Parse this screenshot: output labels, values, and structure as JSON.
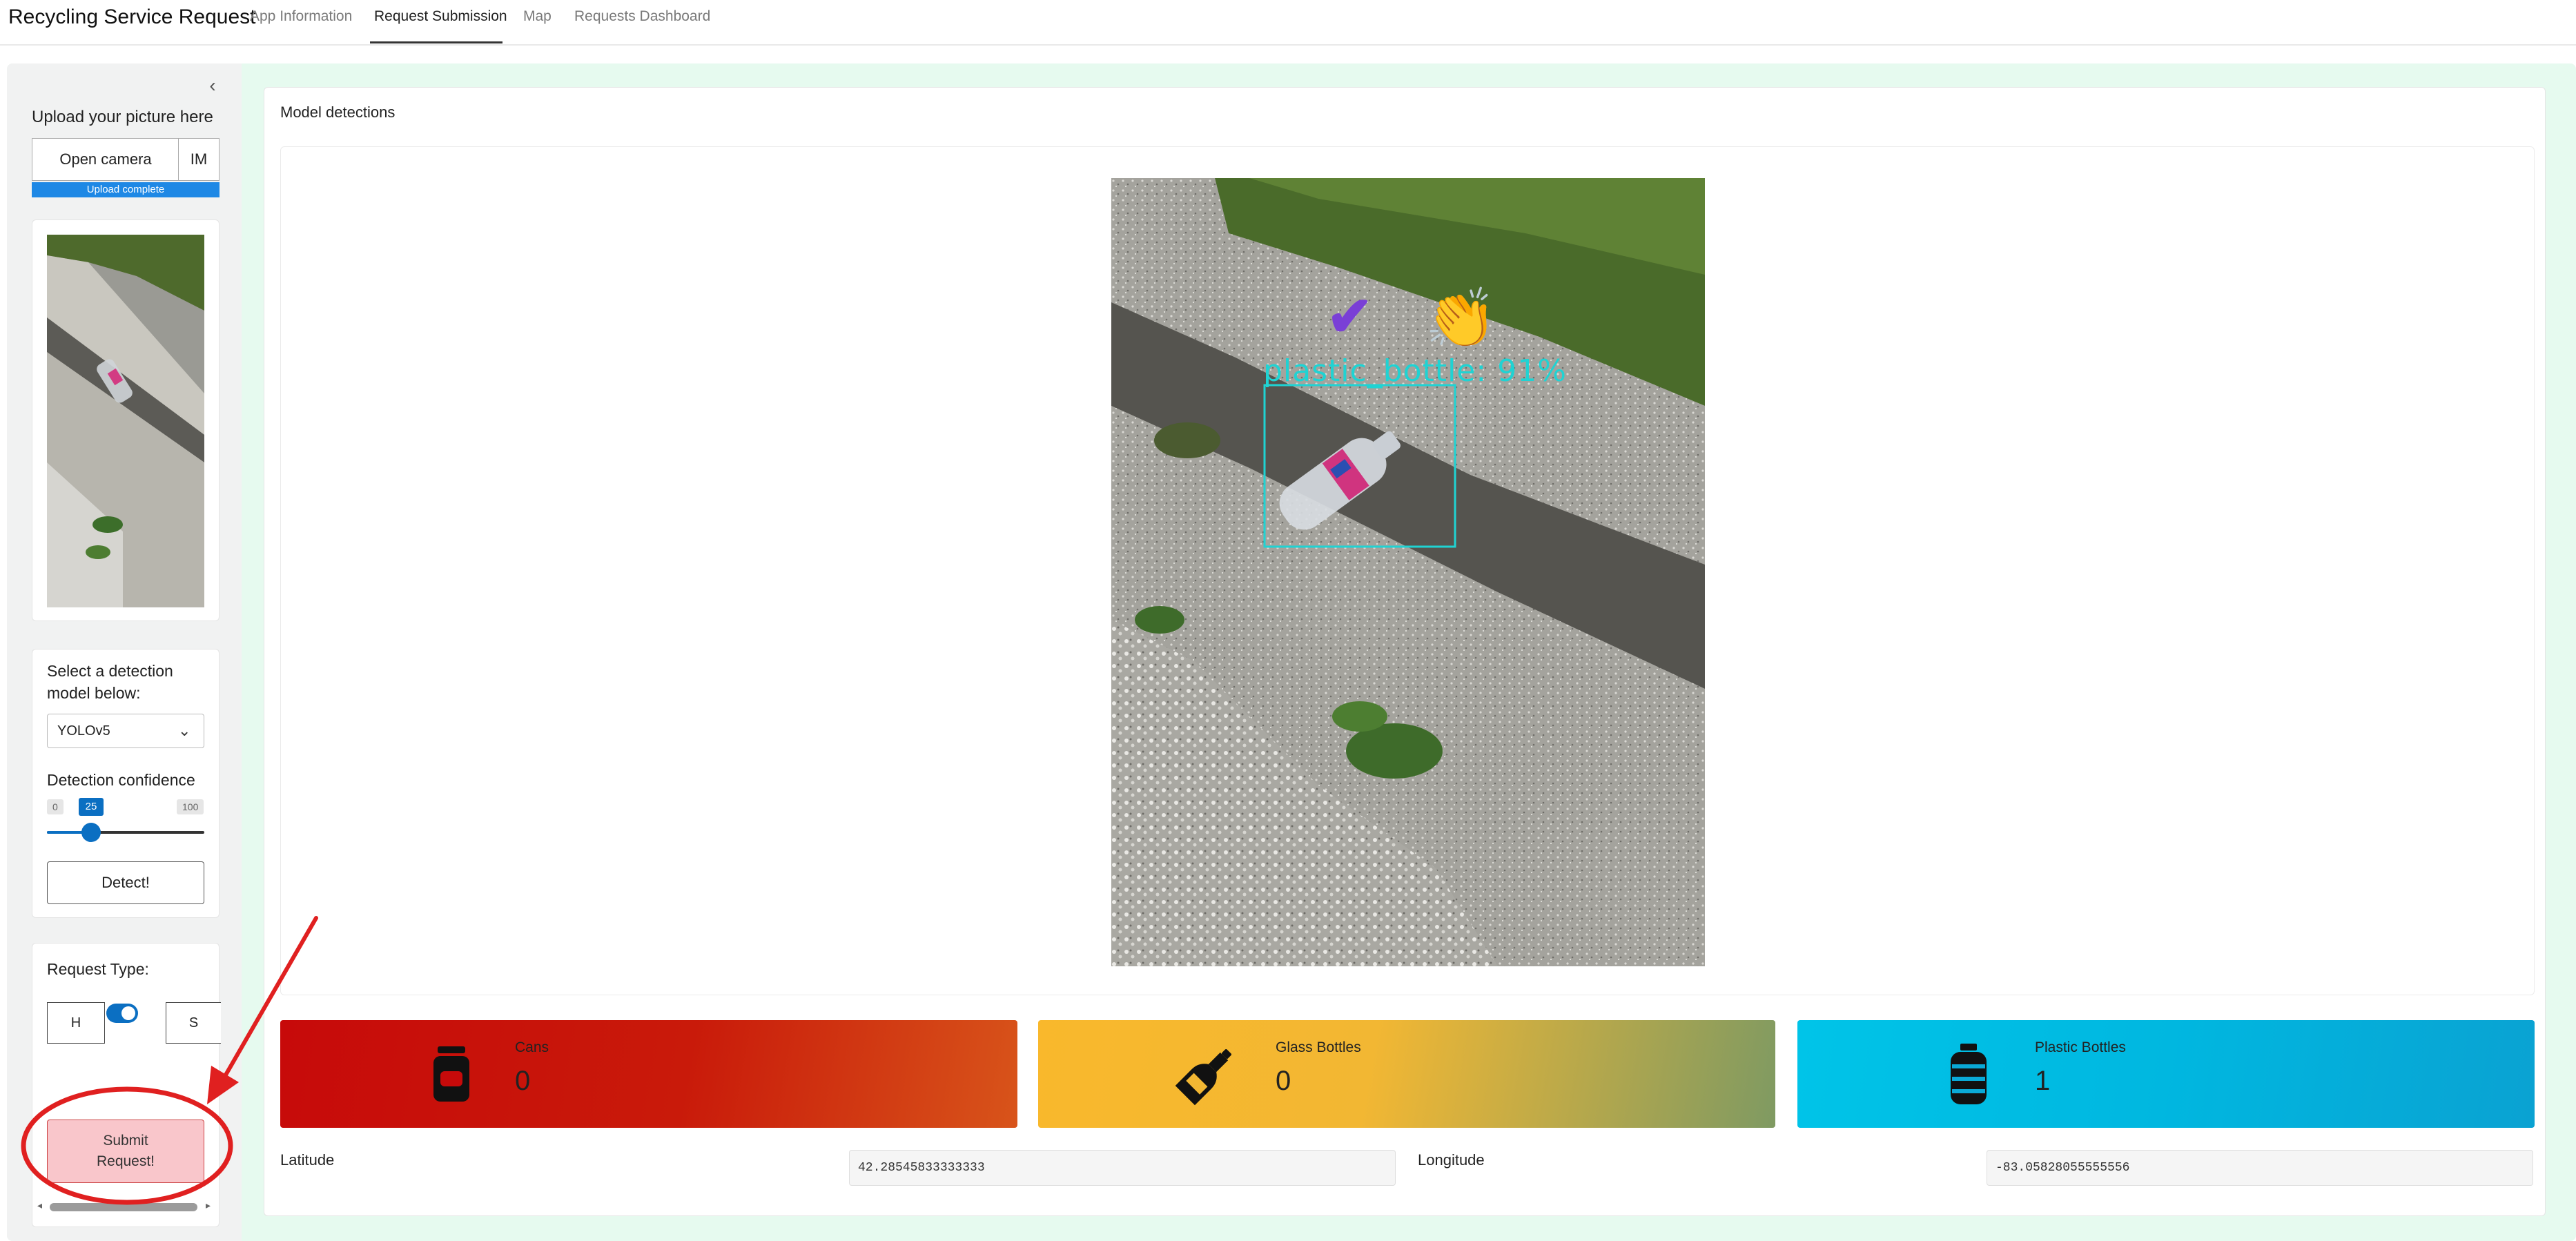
{
  "nav": {
    "brand": "Recycling Service Request",
    "tabs": [
      "App Information",
      "Request Submission",
      "Map",
      "Requests Dashboard"
    ],
    "active_tab": "Request Submission"
  },
  "sidebar": {
    "collapse_icon": "chevron-left-icon",
    "upload_label": "Upload your picture here",
    "camera_button": "Open camera",
    "file_button": "IM",
    "upload_status": "Upload complete",
    "model_label": "Select a detection model below:",
    "model_value": "YOLOv5",
    "confidence_label": "Detection confidence",
    "confidence": {
      "min": "0",
      "max": "100",
      "value": "25"
    },
    "detect_button": "Detect!",
    "request_type_label": "Request Type:",
    "request_type_left": "H",
    "request_type_right": "S",
    "request_toggle_on": true,
    "submit_button": "Submit Request!"
  },
  "main": {
    "title": "Model detections",
    "detection_label": "plastic_bottle: 91%",
    "emoji_check": "✔",
    "emoji_clap": "👏",
    "stats": [
      {
        "name": "Cans",
        "value": "0",
        "icon": "jar-icon"
      },
      {
        "name": "Glass Bottles",
        "value": "0",
        "icon": "bottle-icon"
      },
      {
        "name": "Plastic Bottles",
        "value": "1",
        "icon": "water-jug-icon"
      }
    ],
    "latitude_label": "Latitude",
    "latitude_value": "42.28545833333333",
    "longitude_label": "Longitude",
    "longitude_value": "-83.05828055555556"
  },
  "colors": {
    "accent": "#0b6fc2",
    "cans": "#c70a0a",
    "glass": "#f9b82c",
    "plastic": "#00c4e8",
    "annotation": "#e02020",
    "detection_box": "#1fd3d3"
  }
}
